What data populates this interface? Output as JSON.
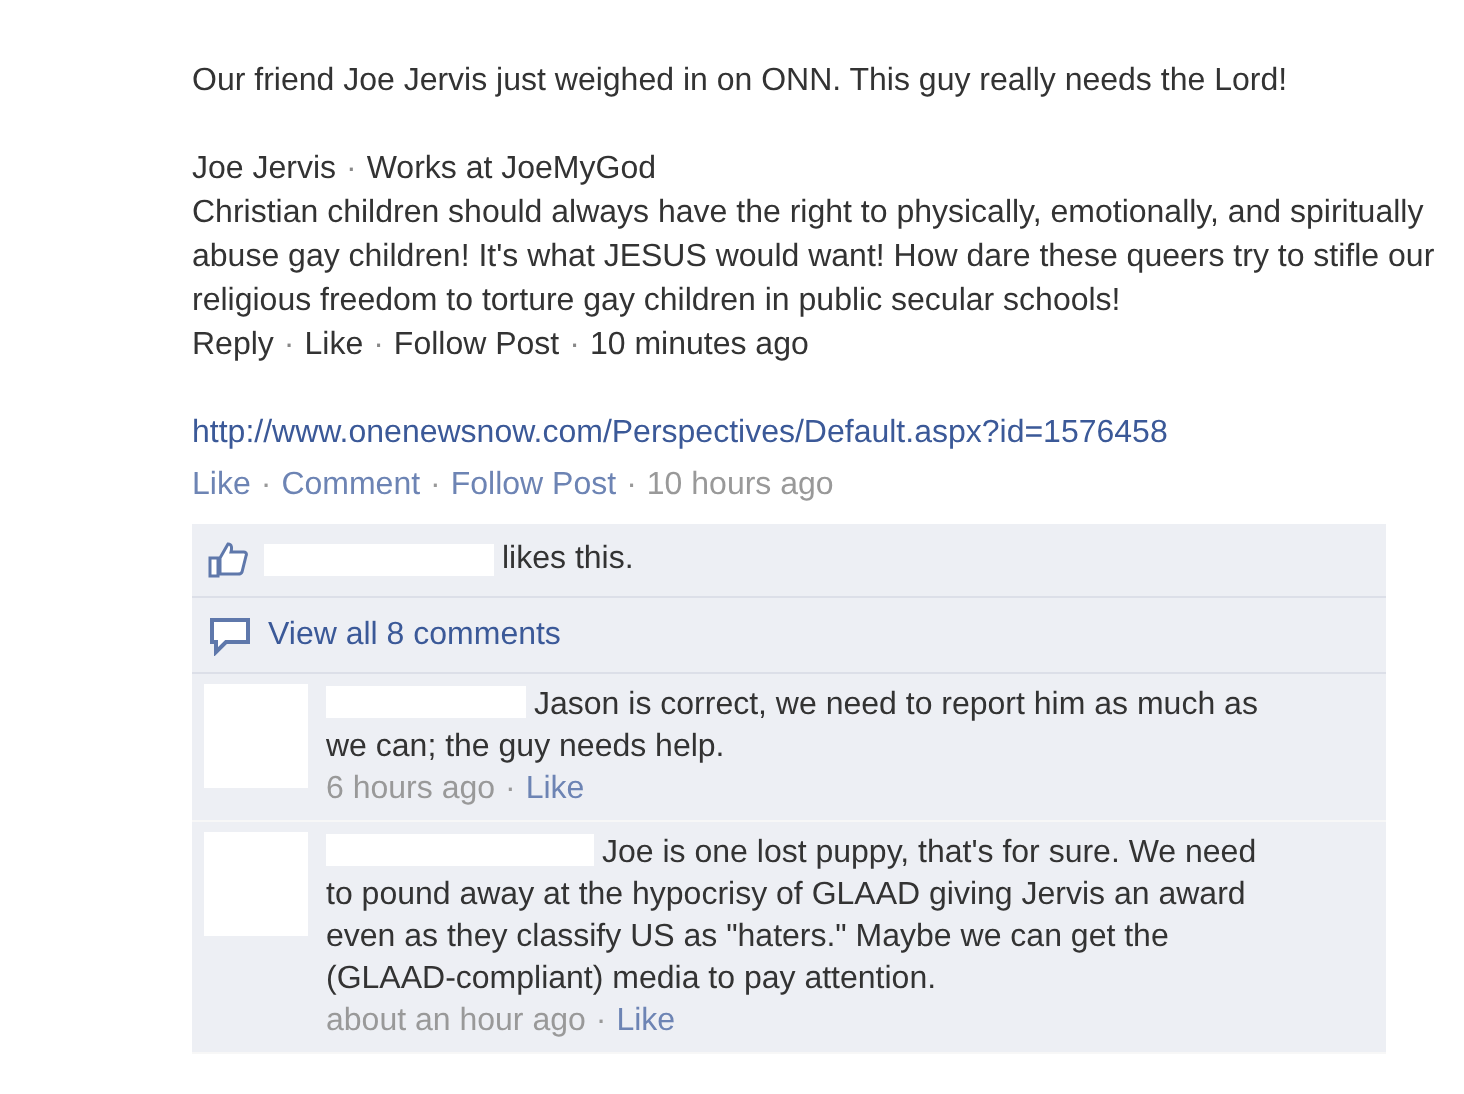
{
  "post": {
    "text": "Our friend Joe Jervis just weighed in on ONN. This guy really needs the Lord!",
    "quote": {
      "author": "Joe Jervis",
      "workplace": "Works at JoeMyGod",
      "body": "Christian children should always have the right to physically, emotionally, and spiritually abuse gay children! It's what JESUS would want! How dare these queers try to stifle our religious freedom to torture gay children in public secular schools!",
      "actions": [
        "Reply",
        "Like",
        "Follow Post"
      ],
      "time": "10 minutes ago"
    },
    "link": "http://www.onenewsnow.com/Perspectives/Default.aspx?id=1576458",
    "actions": [
      "Like",
      "Comment",
      "Follow Post"
    ],
    "time": "10 hours ago",
    "separator": "·"
  },
  "likes": {
    "text": "likes this."
  },
  "view_all": "View all 8 comments",
  "comments": [
    {
      "text": "Jason is correct, we need to report him as much as we can; the guy needs help.",
      "time": "6 hours ago",
      "action": "Like"
    },
    {
      "text": "Joe is one lost puppy, that's for sure. We need to pound away at the hypocrisy of GLAAD giving Jervis an award even as they classify US as \"haters.\" Maybe we can get the (GLAAD-compliant) media to pay attention.",
      "time": "about an hour ago",
      "action": "Like"
    }
  ]
}
